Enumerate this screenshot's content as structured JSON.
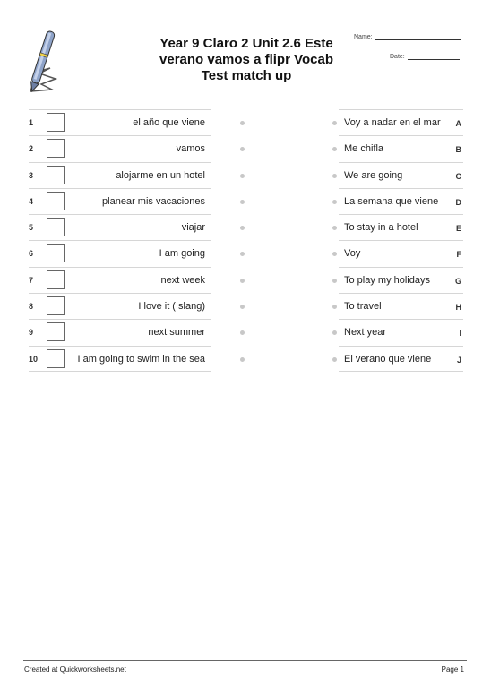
{
  "header": {
    "title_lines": [
      "Year 9 Claro 2 Unit 2.6 Este",
      "verano vamos a flipr  Vocab",
      "Test match up"
    ],
    "name_label": "Name:",
    "date_label": "Date:",
    "logo_icon": "pen-icon"
  },
  "left_items": [
    {
      "number": "1",
      "term": "el año que viene"
    },
    {
      "number": "2",
      "term": "vamos"
    },
    {
      "number": "3",
      "term": "alojarme en un hotel"
    },
    {
      "number": "4",
      "term": "planear mis vacaciones"
    },
    {
      "number": "5",
      "term": "viajar"
    },
    {
      "number": "6",
      "term": "I am going"
    },
    {
      "number": "7",
      "term": "next week"
    },
    {
      "number": "8",
      "term": "I love it ( slang)"
    },
    {
      "number": "9",
      "term": "next summer"
    },
    {
      "number": "10",
      "term": "I am going to swim in the sea"
    }
  ],
  "right_items": [
    {
      "letter": "A",
      "term": "Voy a nadar en el mar"
    },
    {
      "letter": "B",
      "term": "Me chifla"
    },
    {
      "letter": "C",
      "term": "We are going"
    },
    {
      "letter": "D",
      "term": "La semana que viene"
    },
    {
      "letter": "E",
      "term": "To stay in a hotel"
    },
    {
      "letter": "F",
      "term": "Voy"
    },
    {
      "letter": "G",
      "term": "To play my holidays"
    },
    {
      "letter": "H",
      "term": "To travel"
    },
    {
      "letter": "I",
      "term": "Next year"
    },
    {
      "letter": "J",
      "term": "El verano que viene"
    }
  ],
  "footer": {
    "credit": "Created at Quickworksheets.net",
    "page": "Page 1"
  }
}
